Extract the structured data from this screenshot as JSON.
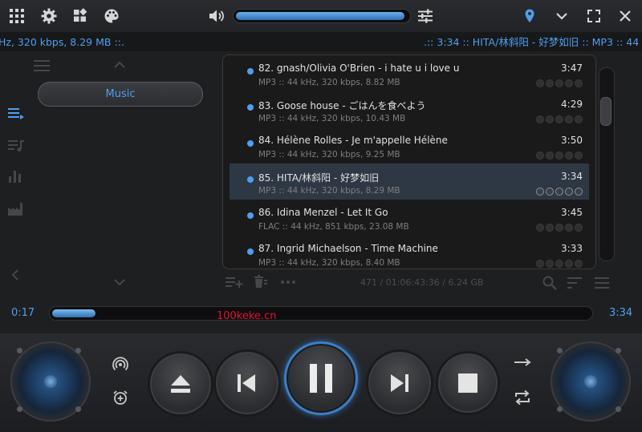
{
  "topbar": {
    "icons": [
      "grid-menu-icon",
      "gear-icon",
      "widgets-icon",
      "palette-icon",
      "volume-icon",
      "equalizer-icon",
      "location-pin-icon",
      "chevron-down-icon",
      "fullscreen-icon",
      "close-icon"
    ],
    "volume_percent": 98
  },
  "marquee": {
    "left_text": "Hz, 320 kbps, 8.29 MB ::.",
    "right_text": ".:: 3:34 :: HITA/林斜阳 - 好梦如旧 :: MP3 :: 44"
  },
  "sidebar": {
    "music_label": "Music"
  },
  "playlist": {
    "rows": [
      {
        "title": "82. gnash/Olivia O'Brien - i hate u i love u",
        "info": "MP3 :: 44 kHz, 320 kbps, 8.82 MB",
        "time": "3:47",
        "selected": false
      },
      {
        "title": "83. Goose house - ごはんを食べよう",
        "info": "MP3 :: 44 kHz, 320 kbps, 10.43 MB",
        "time": "4:29",
        "selected": false
      },
      {
        "title": "84. Hélène Rolles - Je m'appelle Hélène",
        "info": "MP3 :: 44 kHz, 320 kbps, 9.25 MB",
        "time": "3:50",
        "selected": false
      },
      {
        "title": "85. HITA/林斜阳 - 好梦如旧",
        "info": "MP3 :: 44 kHz, 320 kbps, 8.29 MB",
        "time": "3:34",
        "selected": true
      },
      {
        "title": "86. Idina Menzel - Let It Go",
        "info": "FLAC :: 44 kHz, 851 kbps, 23.08 MB",
        "time": "3:45",
        "selected": false
      },
      {
        "title": "87. Ingrid Michaelson - Time Machine",
        "info": "MP3 :: 44 kHz, 320 kbps, 8.40 MB",
        "time": "3:33",
        "selected": false
      }
    ],
    "stats": "471 / 01:06:43:36 / 6.24 GB"
  },
  "playback": {
    "position": "0:17",
    "duration": "3:34",
    "progress_fraction": 0.08,
    "watermark": "100keke.cn"
  },
  "colors": {
    "accent": "#4f9ff0",
    "watermark": "#e0102e"
  }
}
